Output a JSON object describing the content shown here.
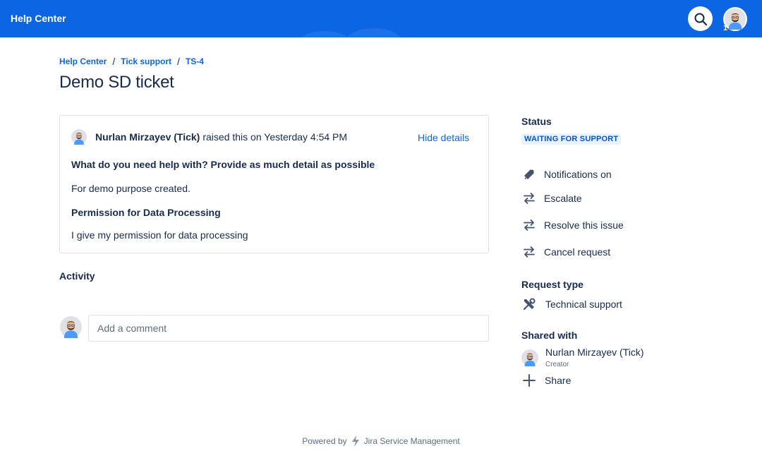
{
  "topbar": {
    "brand": "Help Center",
    "profile_count": "1"
  },
  "icons": {
    "search": "search-icon",
    "avatar": "user-avatar",
    "notifications": "megaphone-icon",
    "transition": "arrows-swap-icon",
    "request_type": "tools-icon",
    "share": "plus-icon",
    "jsm": "jira-service-management-logo"
  },
  "colors": {
    "brand": "#0c66e4",
    "status_bg": "#e9f2ff",
    "status_text": "#0055cc"
  },
  "breadcrumb": [
    "Help Center",
    "Tick support",
    "TS-4"
  ],
  "page_title": "Demo SD ticket",
  "details": {
    "reporter": "Nurlan Mirzayev (Tick)",
    "reporter_meta": "raised this on Yesterday 4:54 PM",
    "hide_details": "Hide details",
    "fields": [
      {
        "label": "What do you need help with? Provide as much detail as possible",
        "value": "For demo purpose created."
      },
      {
        "label": "Permission for Data Processing",
        "value": "I give my permission for data processing"
      }
    ]
  },
  "activity": {
    "title": "Activity",
    "comment_placeholder": "Add a comment"
  },
  "sidebar": {
    "status_label": "Status",
    "status_value": "WAITING FOR SUPPORT",
    "actions": [
      "Notifications on",
      "Escalate",
      "Resolve this issue",
      "Cancel request"
    ],
    "request_type_label": "Request type",
    "request_type_value": "Technical support",
    "shared_with_label": "Shared with",
    "shared_user": "Nurlan Mirzayev (Tick)",
    "shared_role": "Creator",
    "share_label": "Share"
  },
  "footer": {
    "powered_by": "Powered by",
    "product": "Jira Service Management"
  }
}
